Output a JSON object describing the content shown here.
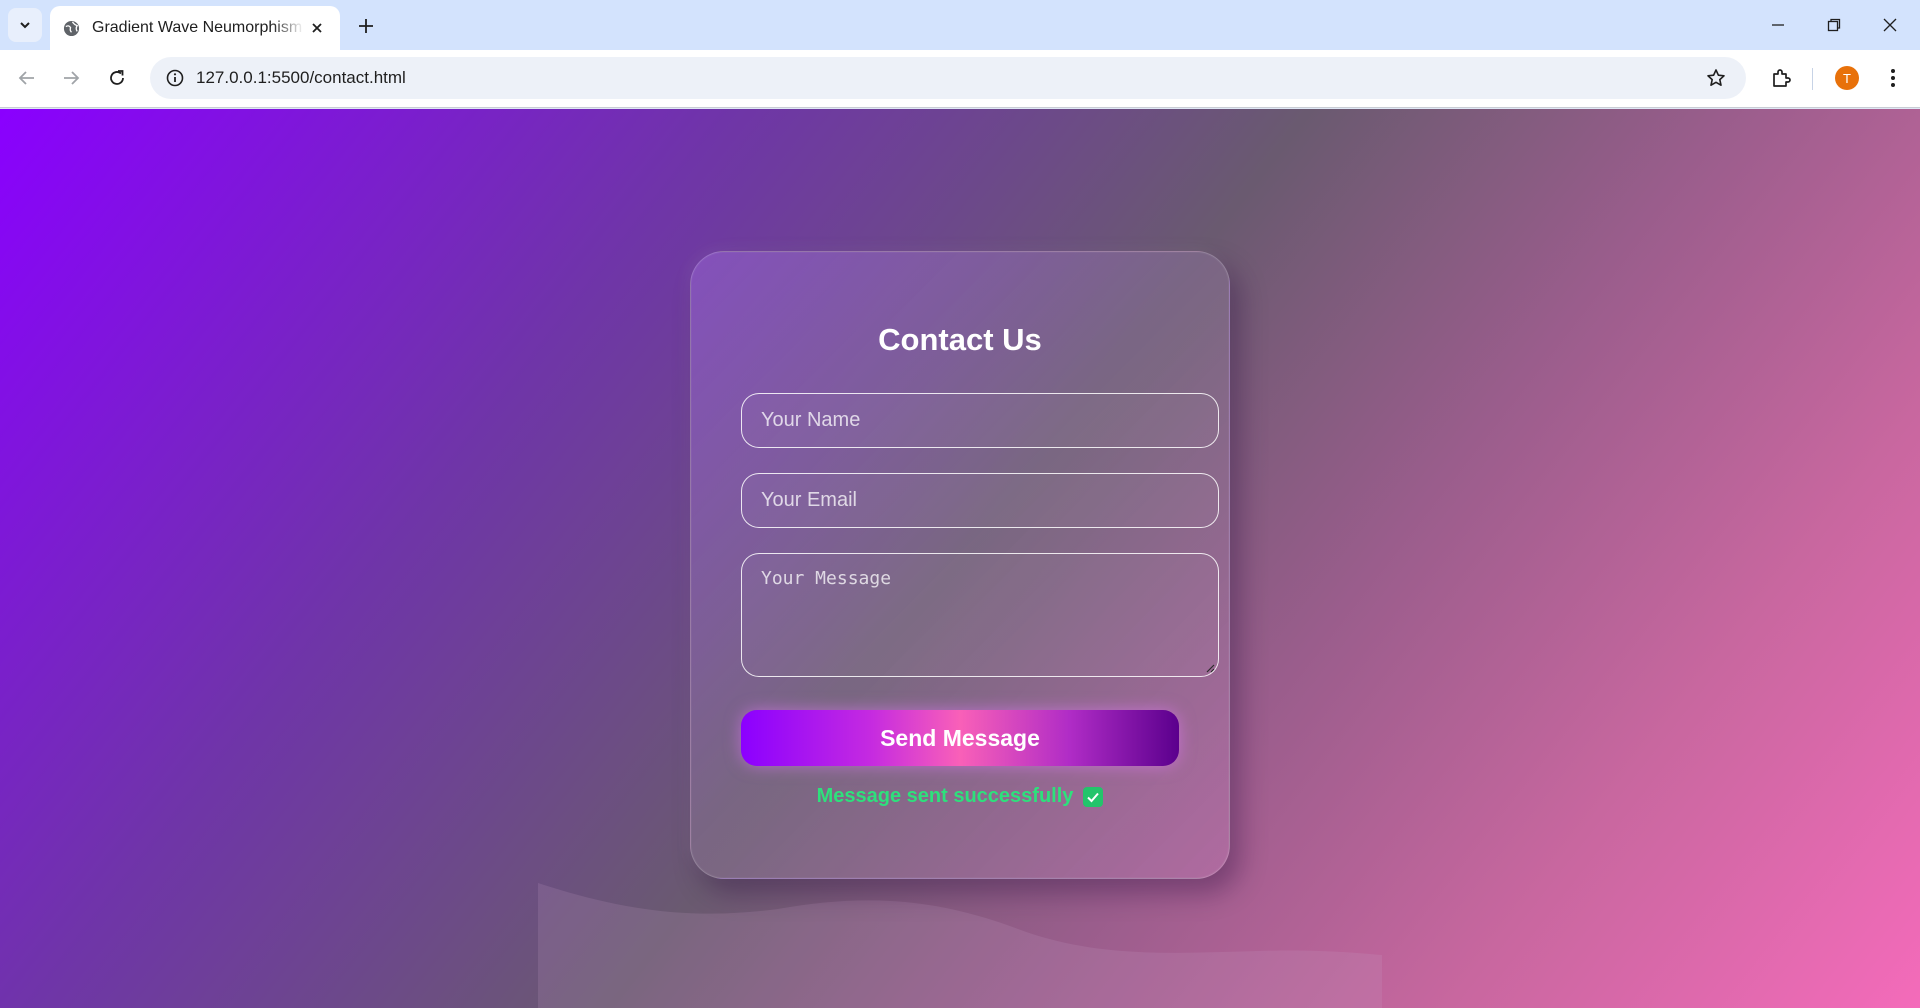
{
  "browser": {
    "tab_title": "Gradient Wave Neumorphism Contact Form",
    "url": "127.0.0.1:5500/contact.html",
    "profile_initial": "T",
    "profile_color": "#e8710a"
  },
  "page": {
    "background_colors": [
      "#8a00ff",
      "#6a5a70",
      "#f46bba"
    ],
    "form": {
      "title": "Contact Us",
      "name_placeholder": "Your Name",
      "email_placeholder": "Your Email",
      "message_placeholder": "Your Message",
      "submit_label": "Send Message",
      "status_message": "Message sent successfully",
      "status_icon": "check-icon",
      "status_color": "#2ee07c"
    }
  }
}
